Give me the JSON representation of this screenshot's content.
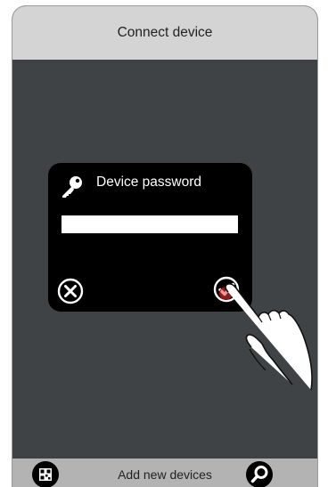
{
  "header": {
    "title": "Connect device"
  },
  "dialog": {
    "title": "Device password",
    "password_value": "",
    "password_placeholder": ""
  },
  "bottom_bar": {
    "label": "Add new devices"
  },
  "icons": {
    "key": "key-icon",
    "cancel": "close-circle-icon",
    "confirm": "check-circle-icon",
    "qr": "qr-code-icon",
    "search": "search-icon",
    "hand": "pointing-hand-icon"
  },
  "colors": {
    "header_bg": "#d4d4d4",
    "content_bg": "#404345",
    "dialog_bg": "#000000",
    "bottom_bar_bg": "#b3b3b3",
    "tap_highlight": "#e03c3c"
  }
}
